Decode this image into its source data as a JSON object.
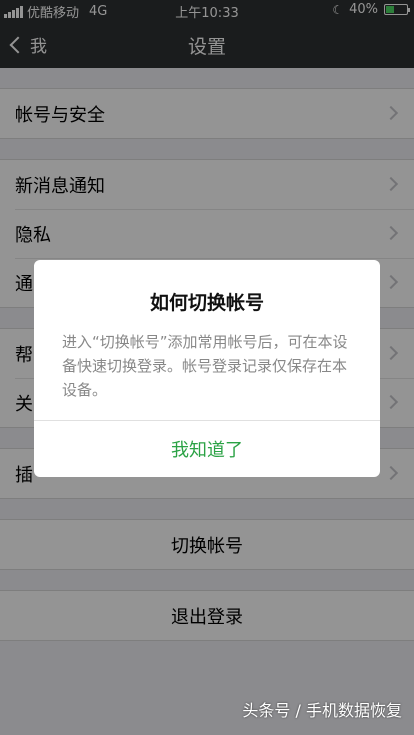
{
  "status_bar": {
    "carrier": "优酷移动",
    "network": "4G",
    "time": "上午10:33",
    "battery": "40%",
    "battery_level": 0.4
  },
  "nav": {
    "back_label": "我",
    "title": "设置"
  },
  "settings": {
    "account_security": "帐号与安全",
    "notifications": "新消息通知",
    "privacy": "隐私",
    "general": "通",
    "help": "帮",
    "about": "关",
    "plugins": "插",
    "switch_account": "切换帐号",
    "logout": "退出登录"
  },
  "dialog": {
    "title": "如何切换帐号",
    "message": "进入“切换帐号”添加常用帐号后，可在本设备快速切换登录。帐号登录记录仅保存在本设备。",
    "button": "我知道了",
    "button_color": "#2ba245"
  },
  "watermark": "头条号 / 手机数据恢复"
}
